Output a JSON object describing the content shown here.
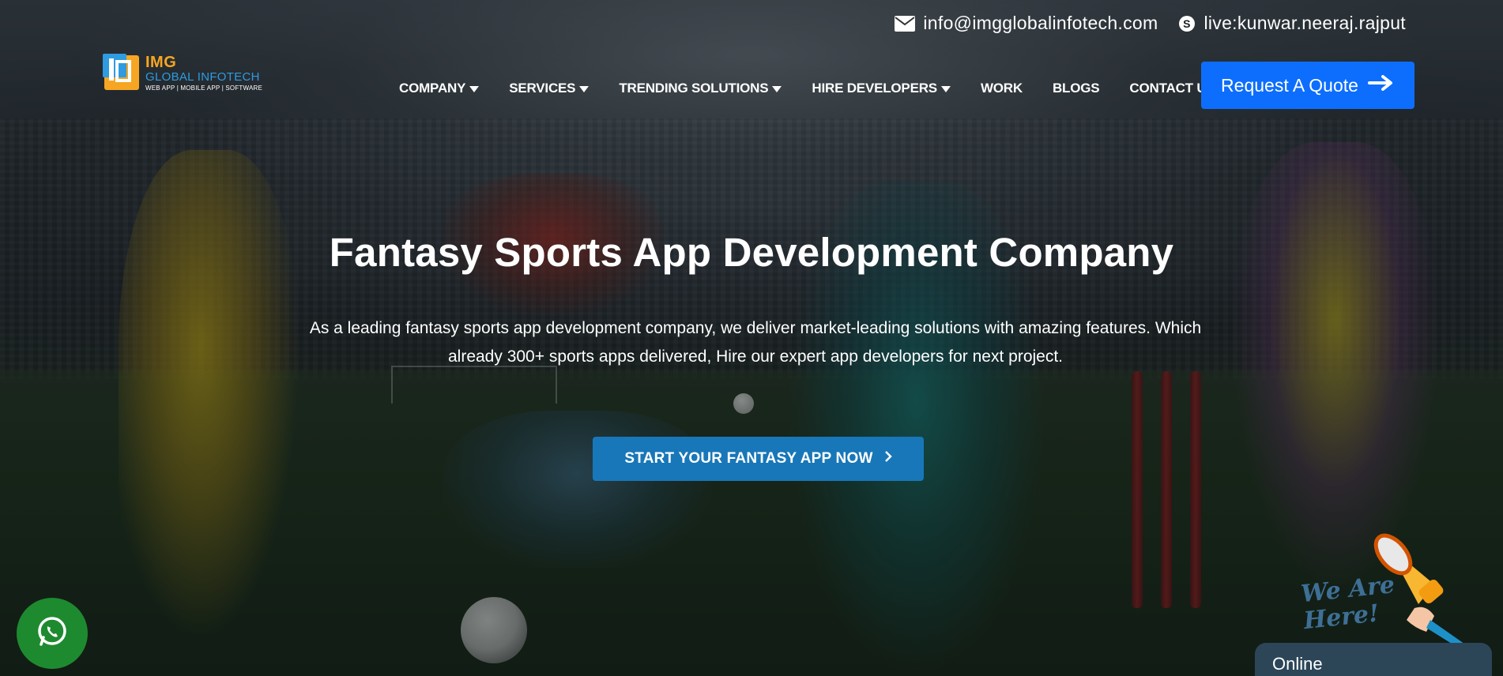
{
  "topbar": {
    "email": "info@imgglobalinfotech.com",
    "skype": "live:kunwar.neeraj.rajput"
  },
  "logo": {
    "name": "IMG",
    "subname": "GLOBAL INFOTECH",
    "tagline": "WEB APP | MOBILE APP | SOFTWARE"
  },
  "nav": {
    "items": [
      {
        "label": "COMPANY",
        "dropdown": true
      },
      {
        "label": "SERVICES",
        "dropdown": true
      },
      {
        "label": "TRENDING SOLUTIONS",
        "dropdown": true
      },
      {
        "label": "HIRE DEVELOPERS",
        "dropdown": true
      },
      {
        "label": "WORK",
        "dropdown": false
      },
      {
        "label": "BLOGS",
        "dropdown": false
      },
      {
        "label": "CONTACT US",
        "dropdown": false
      }
    ],
    "quote_label": "Request A Quote"
  },
  "hero": {
    "title": "Fantasy Sports App Development Company",
    "description": "As a leading fantasy sports app development company, we deliver market-leading solutions with amazing features. Which already 300+ sports apps delivered, Hire our expert app developers for next project.",
    "cta_label": "START YOUR FANTASY APP NOW"
  },
  "widgets": {
    "chat_promo_line1": "We Are",
    "chat_promo_line2": "Here!",
    "chat_status": "Online"
  },
  "colors": {
    "primary_button": "#0d6efd",
    "cta_button": "#1877b8",
    "whatsapp": "#1e8a2f",
    "logo_orange": "#f6a623",
    "logo_blue": "#2f9be0"
  },
  "icons": {
    "email": "envelope-icon",
    "skype": "skype-icon",
    "quote_arrow": "arrow-right-icon",
    "cta_chevron": "chevron-right-icon",
    "whatsapp": "whatsapp-icon",
    "megaphone": "megaphone-icon"
  }
}
